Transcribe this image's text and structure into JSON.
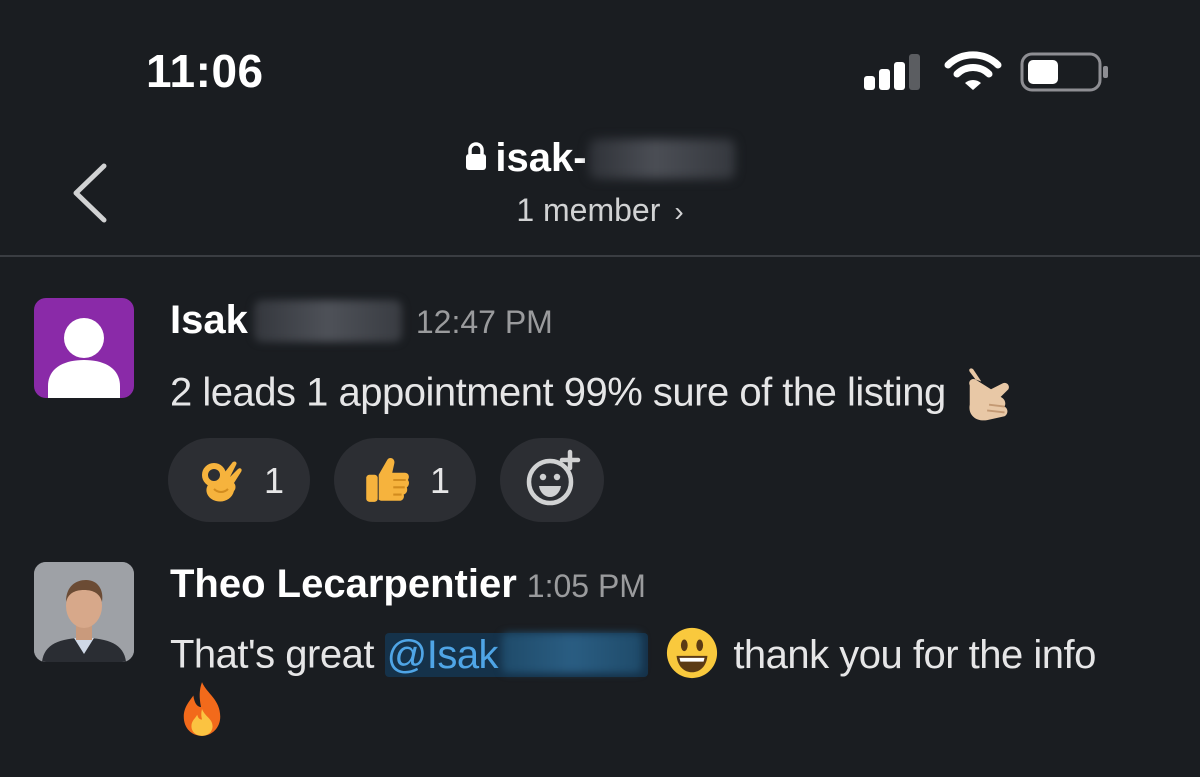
{
  "status_bar": {
    "time": "11:06"
  },
  "header": {
    "channel_prefix": "isak-",
    "members": "1 member"
  },
  "messages": [
    {
      "author": "Isak",
      "time": "12:47 PM",
      "text": "2 leads 1 appointment 99% sure of the listing",
      "emoji": "call-me-hand",
      "reactions": [
        {
          "emoji": "ok-hand",
          "count": "1"
        },
        {
          "emoji": "thumbs-up",
          "count": "1"
        }
      ],
      "add_reaction": "add-reaction-icon"
    },
    {
      "author": "Theo Lecarpentier",
      "time": "1:05 PM",
      "text_before": "That's great",
      "mention": "@Isak",
      "text_after": "thank you for the info",
      "emojis": [
        "smiley",
        "fire"
      ]
    }
  ],
  "colors": {
    "background": "#1a1d21",
    "mention": "#4fa5e6",
    "avatar_purple": "#8a2aa8"
  }
}
